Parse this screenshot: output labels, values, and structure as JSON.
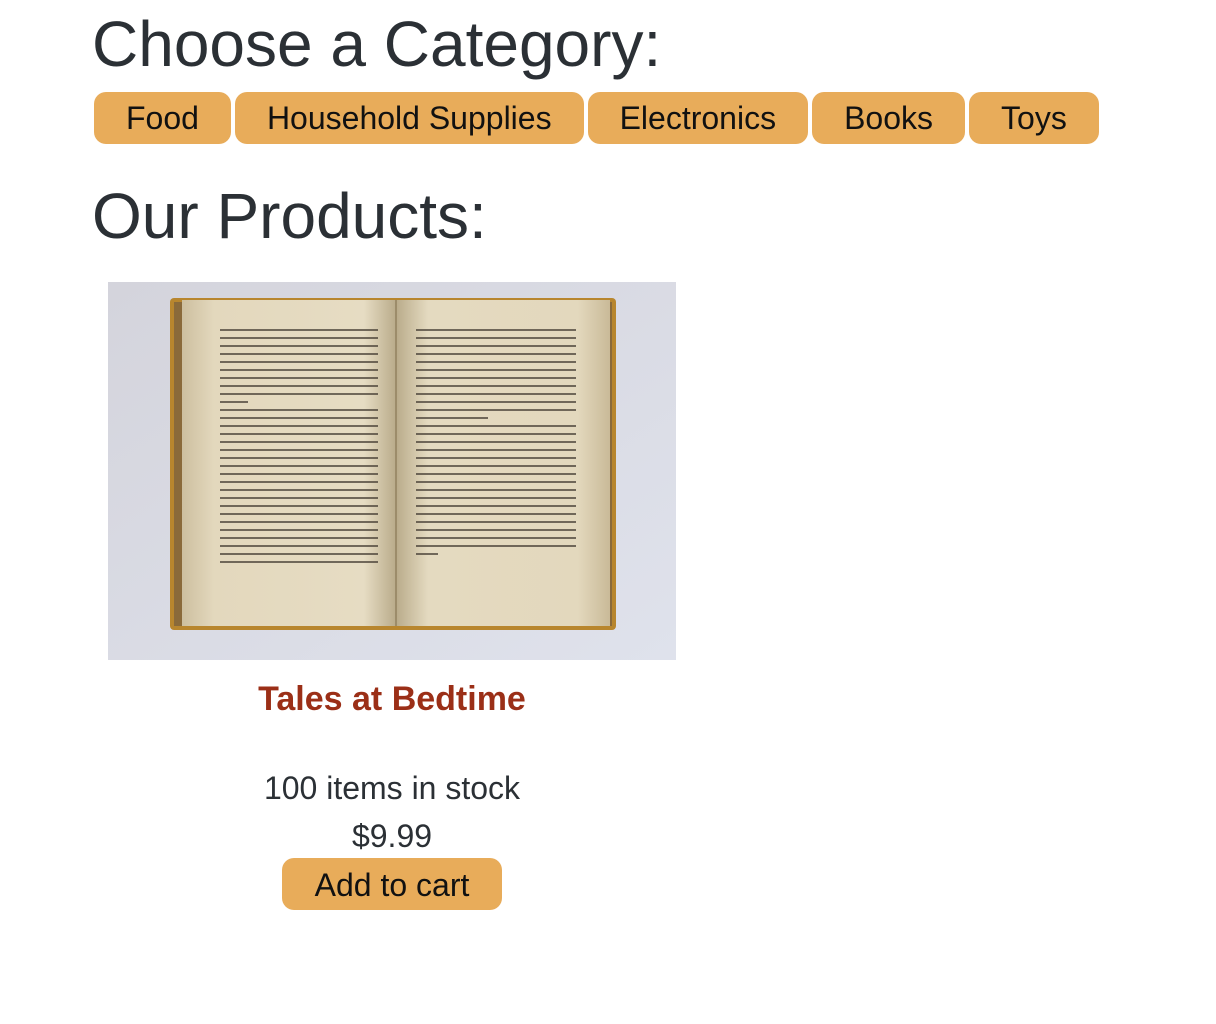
{
  "categories": {
    "heading": "Choose a Category:",
    "items": [
      {
        "label": "Food"
      },
      {
        "label": "Household Supplies"
      },
      {
        "label": "Electronics"
      },
      {
        "label": "Books"
      },
      {
        "label": "Toys"
      }
    ]
  },
  "products": {
    "heading": "Our Products:",
    "items": [
      {
        "name": "Tales at Bedtime",
        "image_icon": "open-book-photo",
        "stock": "100 items in stock",
        "price": "$9.99",
        "cart_label": "Add to cart"
      }
    ]
  },
  "colors": {
    "accent": "#e8ac5a",
    "product_title": "#9b2f17",
    "text": "#2b3035"
  }
}
